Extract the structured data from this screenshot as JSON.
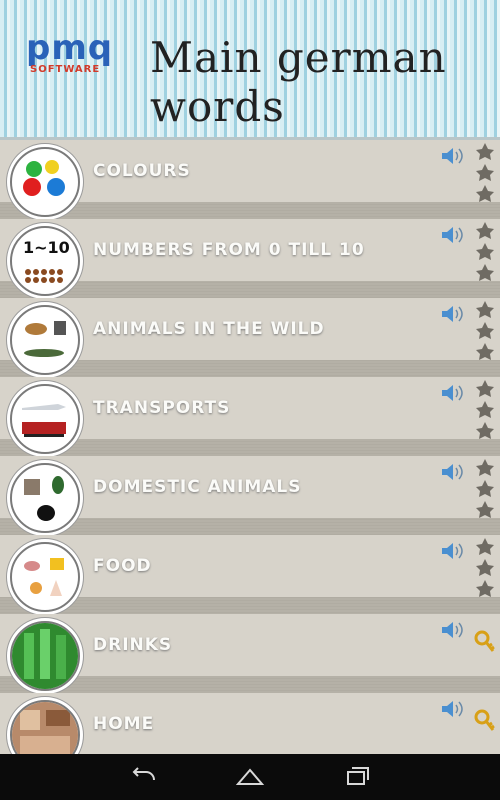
{
  "header": {
    "logo_text": "pmq",
    "logo_subtext": "SOFTWARE",
    "title": "Main german words"
  },
  "categories": [
    {
      "label": "COLOURS",
      "icon": "colours-thumbnail",
      "status": "unlocked"
    },
    {
      "label": "NUMBERS FROM 0 TILL 10",
      "icon": "numbers-thumbnail",
      "thumb_text": "1~10",
      "status": "unlocked"
    },
    {
      "label": "ANIMALS IN THE WILD",
      "icon": "wild-animals-thumbnail",
      "status": "unlocked"
    },
    {
      "label": "TRANSPORTS",
      "icon": "transports-thumbnail",
      "status": "unlocked"
    },
    {
      "label": "DOMESTIC ANIMALS",
      "icon": "domestic-animals-thumbnail",
      "status": "unlocked"
    },
    {
      "label": "FOOD",
      "icon": "food-thumbnail",
      "status": "unlocked"
    },
    {
      "label": "DRINKS",
      "icon": "drinks-thumbnail",
      "status": "locked"
    },
    {
      "label": "HOME",
      "icon": "home-thumbnail",
      "status": "locked"
    }
  ],
  "nav": {
    "back_icon": "back-icon",
    "home_icon": "home-icon",
    "recents_icon": "recents-icon"
  },
  "colors": {
    "accent": "#2a62b8",
    "label_text": "#fbfbf8",
    "nav_bar": "#0b0b0b"
  }
}
